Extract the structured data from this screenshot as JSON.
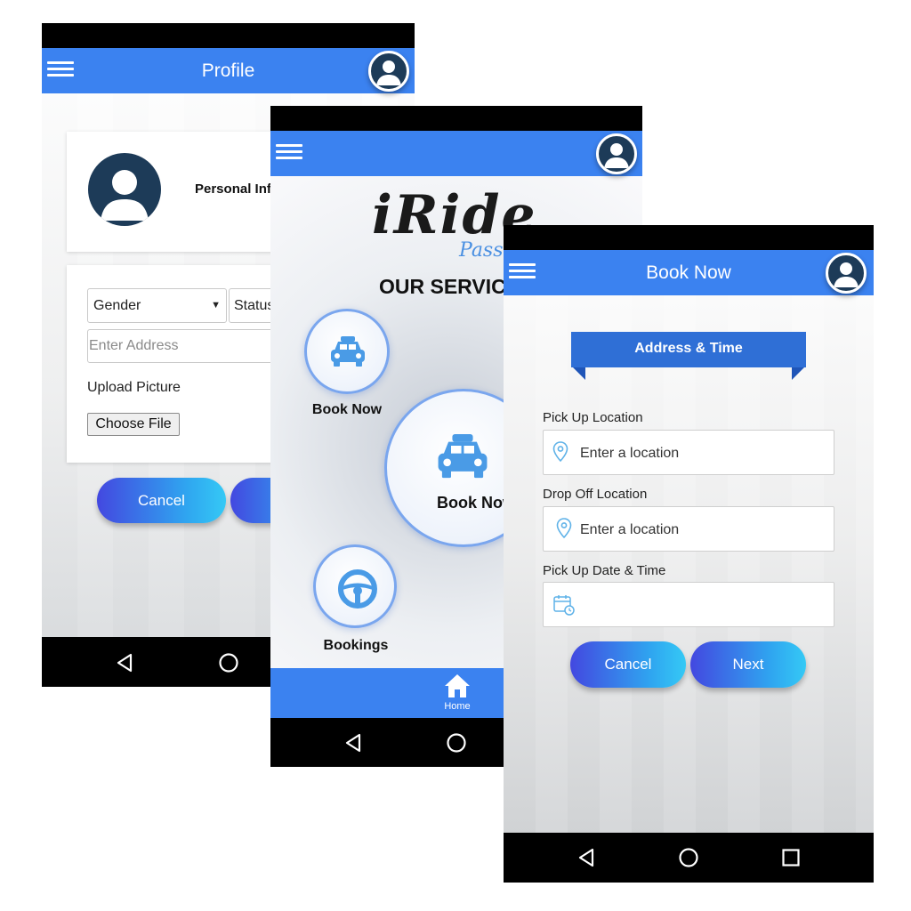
{
  "profile_screen": {
    "title": "Profile",
    "personal_info_label": "Personal Inf",
    "gender_select": "Gender",
    "status_select": "Status",
    "address_placeholder": "Enter Address",
    "upload_label": "Upload Picture",
    "choose_file_button": "Choose File",
    "cancel_button": "Cancel"
  },
  "services_screen": {
    "logo_text": "iRide",
    "logo_sub": "Pass",
    "heading": "OUR SERVIC",
    "book_now_small": "Book Now",
    "book_now_large": "Book Now",
    "bookings": "Bookings",
    "home_tab": "Home"
  },
  "book_screen": {
    "title": "Book Now",
    "ribbon": "Address & Time",
    "pickup_label": "Pick Up Location",
    "pickup_placeholder": "Enter a location",
    "dropoff_label": "Drop Off Location",
    "dropoff_placeholder": "Enter a location",
    "datetime_label": "Pick Up Date & Time",
    "cancel_button": "Cancel",
    "next_button": "Next"
  },
  "colors": {
    "appbar": "#3b82f0",
    "button_gradient_start": "#4348e0",
    "button_gradient_end": "#35c9f5",
    "ribbon": "#2f6fd6"
  },
  "icons": [
    "hamburger-icon",
    "avatar-icon",
    "taxi-icon",
    "steering-wheel-icon",
    "home-icon",
    "location-pin-icon",
    "calendar-icon",
    "back-icon",
    "home-circle-icon",
    "recents-icon"
  ]
}
